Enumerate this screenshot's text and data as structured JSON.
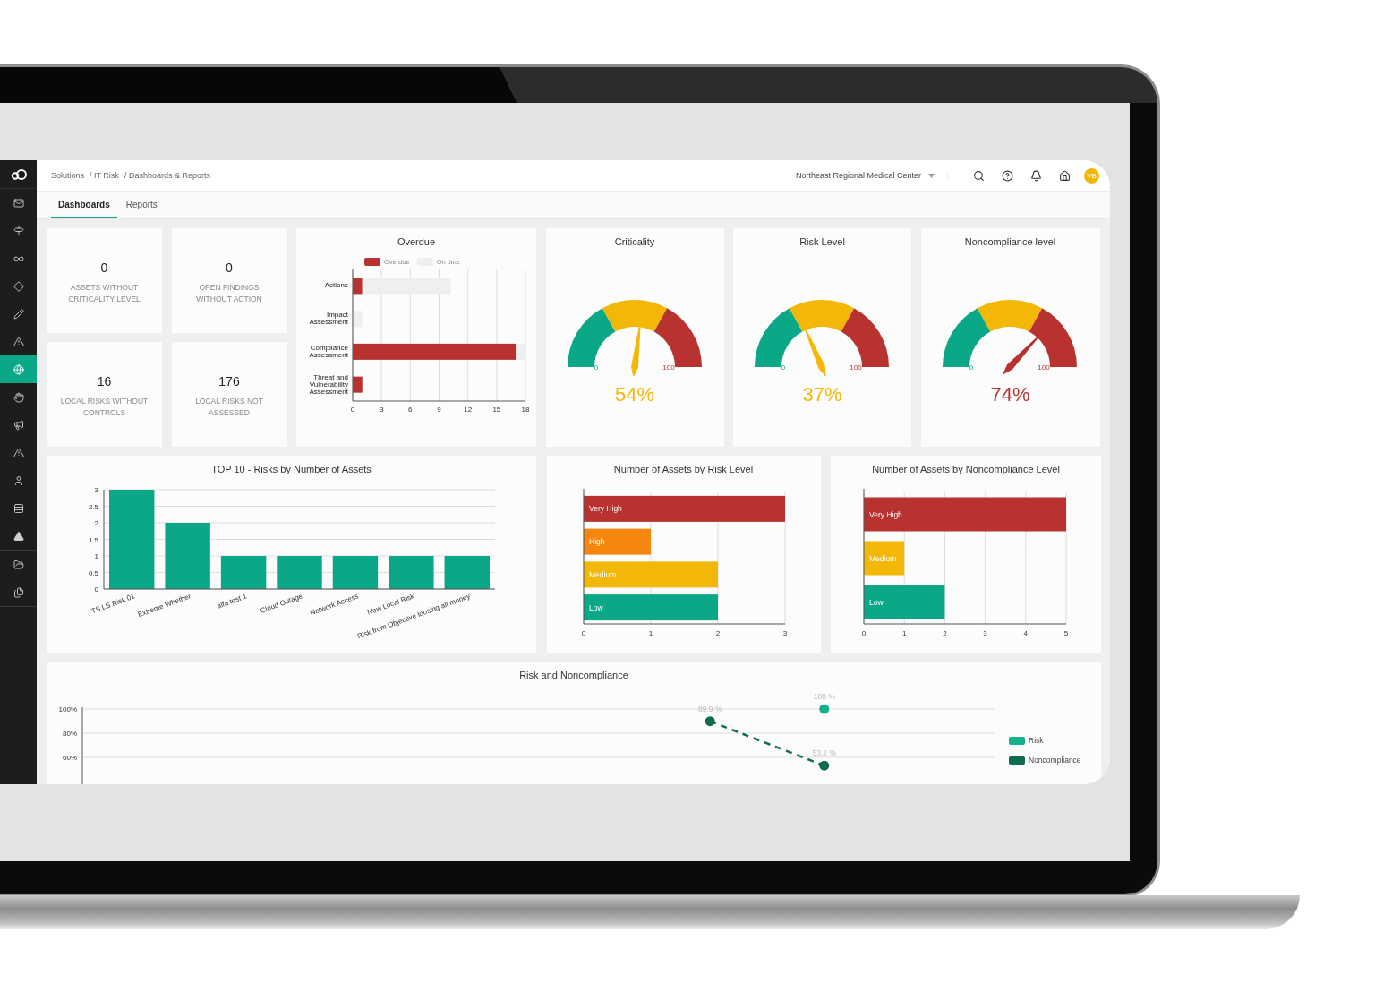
{
  "sidebar": {
    "items": [
      {
        "selected": false
      },
      {
        "selected": false
      },
      {
        "selected": false
      },
      {
        "selected": false
      },
      {
        "selected": false
      },
      {
        "selected": false
      },
      {
        "selected": true
      },
      {
        "selected": false
      },
      {
        "selected": false
      },
      {
        "selected": false
      },
      {
        "selected": false
      },
      {
        "selected": false
      },
      {
        "selected": false
      },
      {
        "selected": false
      },
      {
        "selected": false
      }
    ]
  },
  "topbar": {
    "breadcrumbs": [
      "Solutions",
      "/ IT Risk",
      "/ Dashboards & Reports"
    ],
    "organization": "Northeast Regional Medical Center",
    "avatar": "VB"
  },
  "tabs": [
    {
      "label": "Dashboards",
      "selected": true
    },
    {
      "label": "Reports",
      "selected": false
    }
  ],
  "stats": [
    {
      "value": "0",
      "label": "ASSETS WITHOUT CRITICALITY LEVEL"
    },
    {
      "value": "0",
      "label": "OPEN FINDINGS WITHOUT ACTION"
    },
    {
      "value": "16",
      "label": "LOCAL RISKS WITHOUT CONTROLS"
    },
    {
      "value": "176",
      "label": "LOCAL RISKS NOT ASSESSED"
    }
  ],
  "overdue": {
    "chart_data": {
      "type": "bar",
      "title": "Overdue",
      "orientation": "horizontal",
      "stacked": true,
      "grid": true,
      "categories": [
        "Actions",
        "Impact Assessment",
        "Compliance Assessment",
        "Threat and Vulnerability Assessment"
      ],
      "series": [
        {
          "name": "Overdue",
          "color": "#b83230",
          "values": [
            1,
            0,
            17,
            1
          ]
        },
        {
          "name": "On time",
          "color": "#efefef",
          "values": [
            9.2,
            1,
            1,
            0
          ]
        }
      ],
      "xlim": [
        0,
        18
      ],
      "xticks": [
        0,
        3,
        6,
        9,
        12,
        15,
        18
      ]
    }
  },
  "gauges": [
    {
      "title": "Criticality",
      "reading": "54%",
      "min_label": "0",
      "max_label": "100"
    },
    {
      "title": "Risk Level",
      "reading": "37%",
      "min_label": "0",
      "max_label": "100"
    },
    {
      "title": "Noncompliance level",
      "reading": "74%",
      "min_label": "0",
      "max_label": "100"
    }
  ],
  "top_risks": {
    "chart_data": {
      "type": "bar",
      "title": "TOP 10 - Risks by Number of Assets",
      "grid": true,
      "categories": [
        "TS LS Risk 01",
        "Extreme Whether",
        "alfa test 1",
        "Cloud Outage",
        "Network Access",
        "New Local Risk",
        "Risk from Objective loosing all money"
      ],
      "values": [
        3,
        2,
        1,
        1,
        1,
        1,
        1
      ],
      "ylim": [
        0,
        3
      ],
      "yticks": [
        0,
        0.5,
        1,
        1.5,
        2,
        2.5,
        3
      ]
    }
  },
  "risk_levels": {
    "chart_data": {
      "type": "bar",
      "title": "Number of Assets by Risk Level",
      "orientation": "horizontal",
      "grid": true,
      "series": [
        {
          "name": "Very High",
          "color": "#b83230",
          "values": [
            3,
            null,
            null,
            null
          ]
        },
        {
          "name": "High",
          "color": "#f5870f",
          "values": [
            null,
            1,
            null,
            null
          ]
        },
        {
          "name": "Medium",
          "color": "#f3b807",
          "values": [
            null,
            null,
            2,
            null
          ]
        },
        {
          "name": "Low",
          "color": "#0aa886",
          "values": [
            null,
            null,
            null,
            2
          ]
        }
      ],
      "xlim": [
        0,
        3
      ],
      "xticks": [
        0,
        1,
        2,
        3
      ]
    }
  },
  "noncompliance_levels": {
    "chart_data": {
      "type": "bar",
      "title": "Number of Assets by Noncompliance Level",
      "orientation": "horizontal",
      "grid": true,
      "series": [
        {
          "name": "Very High",
          "color": "#b83230",
          "values": [
            5,
            null,
            null
          ]
        },
        {
          "name": "Medium",
          "color": "#f3b807",
          "values": [
            null,
            1,
            null
          ]
        },
        {
          "name": "Low",
          "color": "#0aa886",
          "values": [
            null,
            null,
            2
          ]
        }
      ],
      "xlim": [
        0,
        5
      ],
      "xticks": [
        0,
        1,
        2,
        3,
        4,
        5
      ]
    }
  },
  "risk_noncompliance": {
    "chart_data": {
      "type": "line",
      "title": "Risk and Noncompliance",
      "grid": true,
      "categories": [
        null,
        null,
        null,
        null,
        null,
        null,
        null,
        null
      ],
      "ylim": [
        0,
        100
      ],
      "yticks": [
        {
          "value": 60,
          "label": "60%"
        },
        {
          "value": 80,
          "label": "80%"
        },
        {
          "value": 100,
          "label": "100%"
        }
      ],
      "series": [
        {
          "name": "Risk",
          "color": "#13b08e",
          "marker": "circle",
          "values": [
            null,
            null,
            null,
            null,
            null,
            null,
            100,
            null
          ]
        },
        {
          "name": "Noncompliance",
          "color": "#0d6b50",
          "line_style": "dashed",
          "marker": "circle",
          "values": [
            null,
            null,
            null,
            null,
            null,
            89.9,
            53.2,
            null
          ]
        }
      ],
      "value_labels": [
        [
          null,
          null,
          null,
          null,
          null,
          null,
          "100 %",
          null
        ],
        [
          null,
          null,
          null,
          null,
          null,
          "89.9 %",
          "53.2 %",
          null
        ]
      ]
    }
  }
}
